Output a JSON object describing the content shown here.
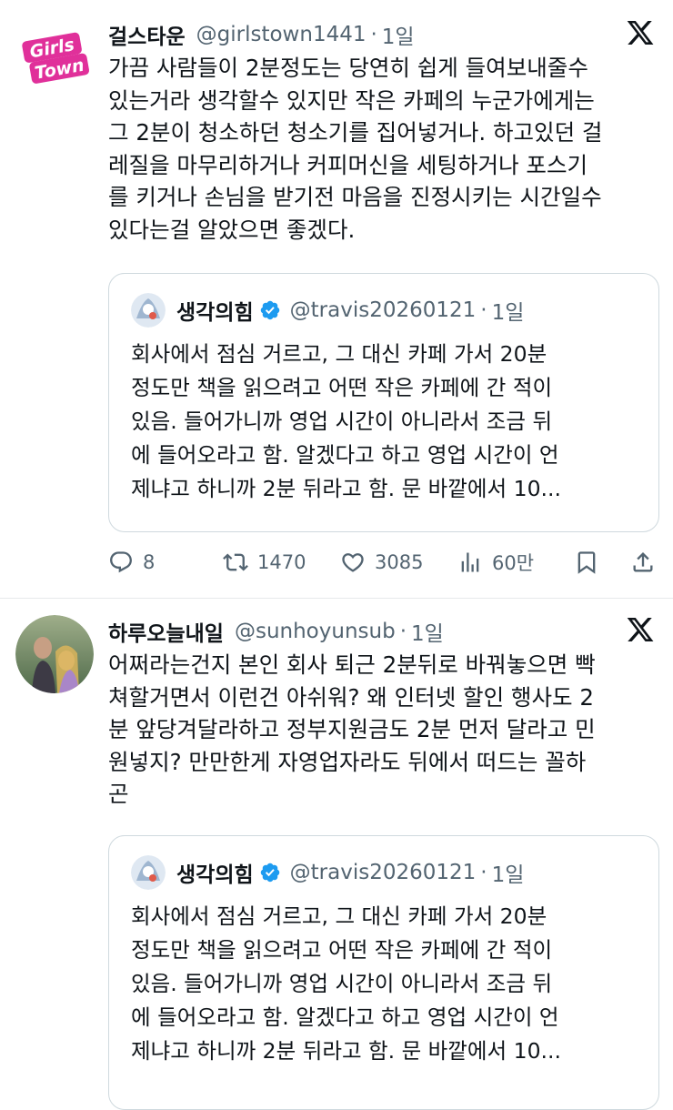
{
  "tweets": [
    {
      "name": "걸스타운",
      "handle": "@girlstown1441",
      "separator": "·",
      "time": "1일",
      "avatar_text": "Girls Town",
      "text": "가끔 사람들이 2분정도는 당연히 쉽게 들여보내줄수\n있는거라 생각할수 있지만 작은 카페의 누군가에게는\n그 2분이 청소하던 청소기를 집어넣거나. 하고있던 걸\n레질을 마무리하거나 커피머신을 세팅하거나 포스기\n를 키거나 손님을 받기전 마음을 진정시키는 시간일수\n있다는걸 알았으면 좋겠다.",
      "quote": {
        "name": "생각의힘",
        "handle": "@travis20260121",
        "separator": "·",
        "time": "1일",
        "text": "회사에서 점심 거르고, 그 대신 카페 가서 20분\n정도만 책을 읽으려고 어떤 작은 카페에 간 적이\n있음. 들어가니까 영업 시간이 아니라서 조금 뒤\n에 들어오라고 함. 알겠다고 하고 영업 시간이 언\n제냐고 하니까 2분 뒤라고 함. 문 바깥에서 10..."
      },
      "stats": {
        "replies": "8",
        "retweets": "1470",
        "likes": "3085",
        "views": "60만"
      }
    },
    {
      "name": "하루오늘내일",
      "handle": "@sunhoyunsub",
      "separator": "·",
      "time": "1일",
      "text": "어쩌라는건지 본인 회사 퇴근 2분뒤로 바꿔놓으면 빡\n쳐할거면서 이런건 아쉬워? 왜 인터넷 할인 행사도 2\n분 앞당겨달라하고 정부지원금도 2분 먼저 달라고 민\n원넣지? 만만한게 자영업자라도 뒤에서 떠드는 꼴하\n곤",
      "quote": {
        "name": "생각의힘",
        "handle": "@travis20260121",
        "separator": "·",
        "time": "1일",
        "text": "회사에서 점심 거르고, 그 대신 카페 가서 20분\n정도만 책을 읽으려고 어떤 작은 카페에 간 적이\n있음. 들어가니까 영업 시간이 아니라서 조금 뒤\n에 들어오라고 함. 알겠다고 하고 영업 시간이 언\n제냐고 하니까 2분 뒤라고 함. 문 바깥에서 10..."
      }
    }
  ],
  "colors": {
    "text": "#0f1419",
    "secondary": "#536471",
    "border": "#cfd9de",
    "verified": "#1d9bf0",
    "brand_pink": "#e0309a"
  },
  "icons": [
    "x-logo-icon",
    "verified-badge-icon",
    "reply-icon",
    "retweet-icon",
    "like-icon",
    "views-icon",
    "bookmark-icon",
    "share-icon"
  ]
}
